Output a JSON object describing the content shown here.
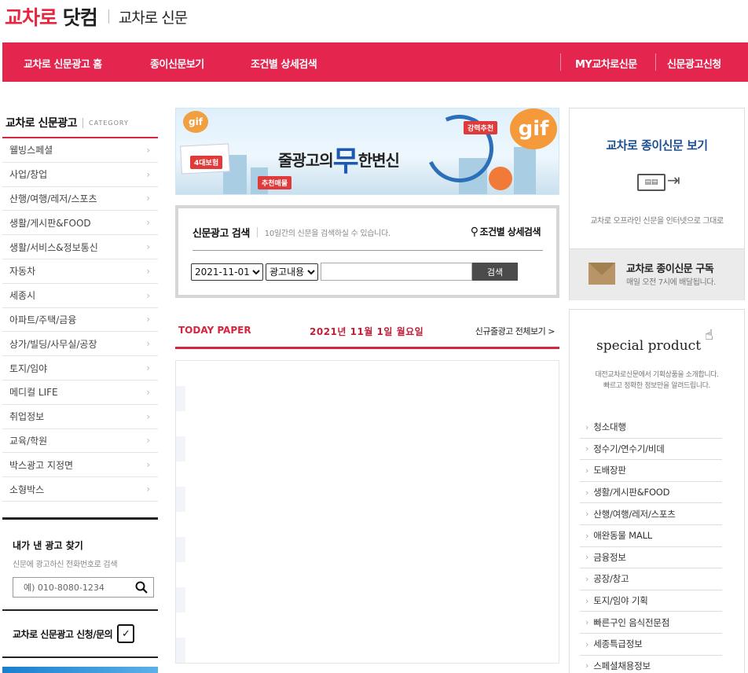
{
  "logo": {
    "brand": "교차로",
    "brand_suffix": "닷컴",
    "section": "교차로 신문"
  },
  "gnb": {
    "left": [
      "교차로 신문광고 홈",
      "종이신문보기",
      "조건별 상세검색"
    ],
    "right": [
      "MY교차로신문",
      "신문광고신청"
    ]
  },
  "lnb": {
    "title": "교차로 신문광고",
    "category_label": "CATEGORY",
    "items": [
      "웰빙스페셜",
      "사업/창업",
      "산행/여행/레저/스포츠",
      "생활/게시판&FOOD",
      "생활/서비스&정보통신",
      "자동차",
      "세종시",
      "아파트/주택/금융",
      "상가/빌딩/사무실/공장",
      "토지/임야",
      "메디컬 LIFE",
      "취업정보",
      "교육/학원",
      "박스광고 지정면",
      "소형박스"
    ]
  },
  "my_ad": {
    "title": "내가 낸 광고 찾기",
    "desc": "신문에 광고하신 전화번호로 검색",
    "placeholder": "예) 010-8080-1234"
  },
  "request": {
    "label": "교차로 신문광고 신청/문의"
  },
  "banner": {
    "text_before": "줄광고의",
    "text_mid": "무",
    "text_after": "한변신",
    "tag1": "강력추천",
    "tag2": "4대보험",
    "tag3": "추천매물",
    "gif": "gif"
  },
  "search": {
    "title": "신문광고 검색",
    "desc": "10일간의 신문을 검색하실 수 있습니다.",
    "advanced": "조건별 상세검색",
    "date_value": "2021-11-01",
    "type_value": "광고내용",
    "button": "검색"
  },
  "today": {
    "label": "TODAY PAPER",
    "date": "2021년 11월 1일 월요일",
    "all": "신규줄광고 전체보기 >"
  },
  "paper_view": {
    "title": "교차로 종이신문 보기",
    "desc": "교차로 오프라인 신문을 인터넷으로 그대로",
    "sub_title": "교차로 종이신문 구독",
    "sub_desc": "매일 오전 7시에 배달됩니다."
  },
  "special": {
    "title": "special product",
    "desc_line1": "대전교차로신문에서 기획상품을 소개합니다.",
    "desc_line2": "빠르고 정확한 정보만을 알려드립니다.",
    "items": [
      "청소대행",
      "정수기/연수기/비데",
      "도배장판",
      "생활/게시판&FOOD",
      "산행/여행/레저/스포츠",
      "애완동물 MALL",
      "금융정보",
      "공장/창고",
      "토지/임야 기획",
      "빠른구인 음식전문점",
      "세종특급정보",
      "스페셜채용정보"
    ]
  },
  "colors": {
    "brand_red": "#e4254e",
    "accent_red": "#d6253f",
    "navy": "#1d4f91"
  }
}
